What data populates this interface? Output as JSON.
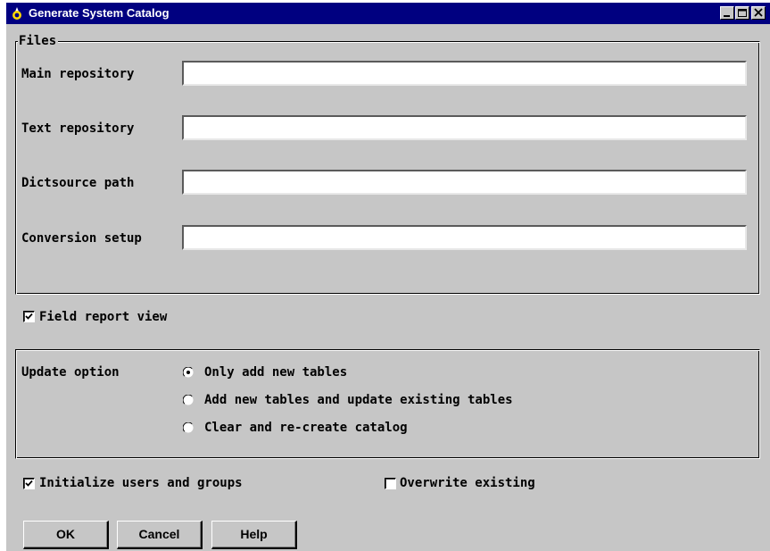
{
  "window": {
    "title": "Generate System Catalog",
    "controls": {
      "minimize": "minimize",
      "maximize": "maximize",
      "close": "close"
    }
  },
  "files": {
    "legend": "Files",
    "fields": [
      {
        "label": "Main repository",
        "value": ""
      },
      {
        "label": "Text repository",
        "value": ""
      },
      {
        "label": "Dictsource path",
        "value": ""
      },
      {
        "label": "Conversion setup",
        "value": ""
      }
    ]
  },
  "field_report_view": {
    "label": "Field report view",
    "checked": true
  },
  "update_option": {
    "label": "Update option",
    "options": [
      {
        "label": "Only add new tables",
        "selected": true
      },
      {
        "label": "Add new tables and update existing tables",
        "selected": false
      },
      {
        "label": "Clear and re-create catalog",
        "selected": false
      }
    ]
  },
  "initialize_users": {
    "label": "Initialize users and groups",
    "checked": true
  },
  "overwrite_existing": {
    "label": "Overwrite existing",
    "checked": false
  },
  "buttons": {
    "ok": "OK",
    "cancel": "Cancel",
    "help": "Help"
  },
  "colors": {
    "titlebar": "#000080",
    "face": "#c6c6c6",
    "title_icon": "#ffd700"
  }
}
